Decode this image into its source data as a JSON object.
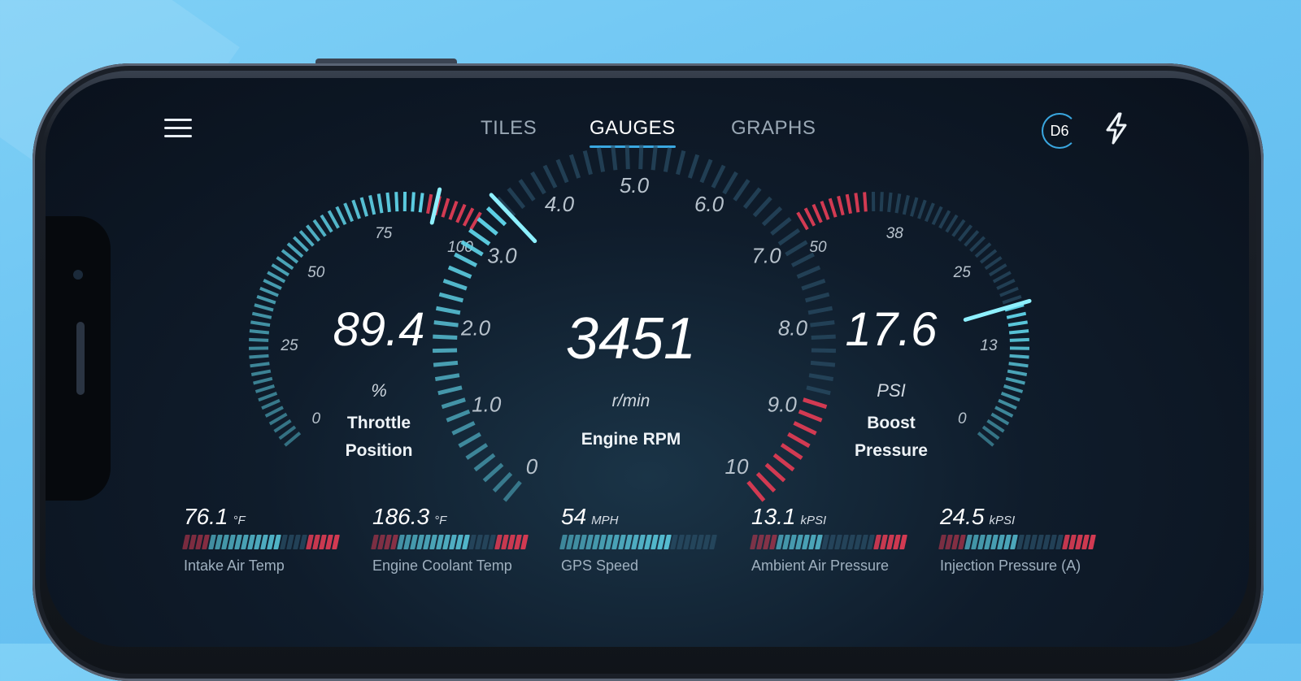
{
  "nav": {
    "tabs": [
      {
        "label": "TILES",
        "active": false
      },
      {
        "label": "GAUGES",
        "active": true
      },
      {
        "label": "GRAPHS",
        "active": false
      }
    ],
    "device_badge": "D6",
    "menu_icon": "hamburger-menu-icon",
    "bolt_icon": "lightning-bolt-icon"
  },
  "colors": {
    "accent": "#3aa7e0",
    "cyan": "#5fd3e8",
    "danger": "#d23a52"
  },
  "gauges": {
    "throttle": {
      "value": "89.4",
      "unit": "%",
      "name_line1": "Throttle",
      "name_line2": "Position",
      "ticks": [
        "0",
        "25",
        "50",
        "75",
        "100"
      ],
      "min": 0,
      "max": 100,
      "reading": 89.4
    },
    "rpm": {
      "value": "3451",
      "unit": "r/min",
      "name": "Engine RPM",
      "ticks": [
        "0",
        "1.0",
        "2.0",
        "3.0",
        "4.0",
        "5.0",
        "6.0",
        "7.0",
        "8.0",
        "9.0",
        "10"
      ],
      "min": 0,
      "max": 10,
      "reading": 3.451
    },
    "boost": {
      "value": "17.6",
      "unit": "PSI",
      "name_line1": "Boost",
      "name_line2": "Pressure",
      "ticks": [
        "0",
        "13",
        "25",
        "38",
        "50"
      ],
      "min": 0,
      "max": 50,
      "reading": 17.6
    }
  },
  "mini_gauges": [
    {
      "value": "76.1",
      "unit": "°F",
      "label": "Intake Air Temp",
      "level": 0.62
    },
    {
      "value": "186.3",
      "unit": "°F",
      "label": "Engine Coolant Temp",
      "level": 0.62
    },
    {
      "value": "54",
      "unit": "MPH",
      "label": "GPS Speed",
      "level": 0.72
    },
    {
      "value": "13.1",
      "unit": "kPSI",
      "label": "Ambient Air Pressure",
      "level": 0.45
    },
    {
      "value": "24.5",
      "unit": "kPSI",
      "label": "Injection Pressure (A)",
      "level": 0.5
    }
  ]
}
